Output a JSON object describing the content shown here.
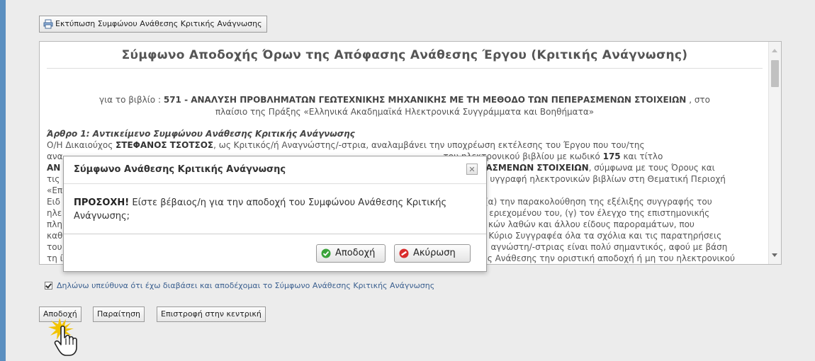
{
  "toolbar": {
    "print_label": "Εκτύπωση Συμφώνου Ανάθεσης Κριτικής Ανάγνωσης"
  },
  "document": {
    "title": "Σύμφωνο Αποδοχής Όρων της Απόφασης Ανάθεσης Έργου (Κριτικής Ανάγνωσης)",
    "book_prefix": "για το βιβλίο :",
    "book_code_title": "571 - ΑΝΑΛΥΣΗ ΠΡΟΒΛΗΜΑΤΩΝ ΓΕΩΤΕΧΝΙΚΗΣ ΜΗΧΑΝΙΚΗΣ ΜΕ ΤΗ ΜΕΘΟΔΟ ΤΩΝ ΠΕΠΕΡΑΣΜΕΝΩΝ ΣΤΟΙΧΕΙΩΝ",
    "book_suffix": ", στο",
    "book_context": "πλαίσιο της Πράξης «Ελληνικά Ακαδημαϊκά Ηλεκτρονικά Συγγράμματα και Βοηθήματα»",
    "article1_heading": "Άρθρο 1: Αντικείμενο Συμφώνου Ανάθεσης Κριτικής Ανάγνωσης",
    "line1_a": "Ο/Η Δικαιούχος",
    "line1_name": "ΣΤΕΦΑΝΟΣ ΤΣΟΤΣΟΣ",
    "line1_b": ", ως Κριτικός/ή Αναγνώστης/-στρια, αναλαμβάνει την υποχρέωση εκτέλεσης του Έργου που του/της",
    "line2_a": "ανα",
    "line2_b": "του ηλεκτρονικού βιβλίου με κωδικό",
    "line2_code": "175",
    "line2_c": "και τίτλο",
    "line3_a": "ΑΝ",
    "line3_b": "ΑΣΜΕΝΩΝ ΣΤΟΙΧΕΙΩΝ",
    "line3_c": ", σύμφωνα με τους Όρους και",
    "line4_a": "τις",
    "line4_b": "υγγραφή ηλεκτρονικών βιβλίων στη Θεματική Περιοχή",
    "line5_a": "«Επ",
    "line6_a": "Ειδ",
    "line6_b": "(α) την παρακολούθηση της εξέλιξης συγγραφής του",
    "line7_a": "ηλε",
    "line7_b": "εριεχομένου του, (γ) τον έλεγχο της επιστημονικής",
    "line8_a": "πλη",
    "line8_b": "κών λαθών και άλλου είδους παροραμάτων, που",
    "line9_a": "καθ",
    "line9_b": "Κύριο Συγγραφέα όλα τα σχόλια και τις παρατηρήσεις",
    "line10_a": "του",
    "line10_b": "αγνώστη/-στριας είναι πολύ σημαντικός, αφού με βάση",
    "line11_a": "τη ί",
    "line11_b": "ς Ανάθεσης την οριστική αποδοχή ή μη του ηλεκτρονικού"
  },
  "dialog": {
    "title": "Σύμφωνο Ανάθεσης Κριτικής Ανάγνωσης",
    "close_symbol": "✕",
    "warning_label": "ΠΡΟΣΟΧΗ!",
    "message": "Είστε βέβαιος/η για την αποδοχή του Συμφώνου Ανάθεσης Κριτικής Ανάγνωσης;",
    "accept_label": "Αποδοχή",
    "cancel_label": "Ακύρωση"
  },
  "declaration": {
    "checked": true,
    "label": "Δηλώνω υπεύθυνα ότι έχω διαβάσει και αποδέχομαι το Σύμφωνο Ανάθεσης Κριτικής Ανάγνωσης"
  },
  "actions": {
    "accept_label": "Αποδοχή",
    "resign_label": "Παραίτηση",
    "back_label": "Επιστροφή στην κεντρική"
  },
  "icons": {
    "print": "printer-icon",
    "accept": "check-circle-icon",
    "cancel": "no-entry-icon",
    "cursor": "hand-pointer-icon"
  },
  "colors": {
    "sidebar": "#5b8fc0",
    "link_text": "#3a5f8f",
    "accept_icon": "#3aa33a",
    "cancel_icon": "#d92c2c",
    "click_burst": "#f2c300"
  }
}
